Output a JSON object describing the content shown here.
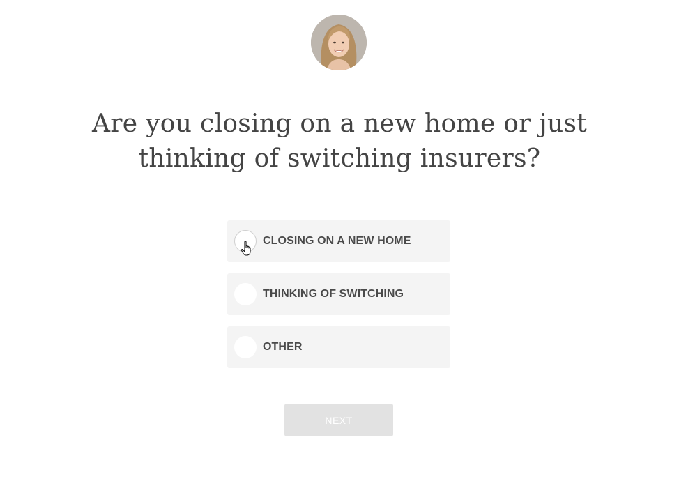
{
  "header": {
    "avatar_icon": "person-avatar-photo"
  },
  "question": {
    "line1": "Are you closing on a new home or just",
    "line2": "thinking of switching insurers?"
  },
  "options": [
    {
      "label": "CLOSING ON A NEW HOME",
      "selected": false
    },
    {
      "label": "THINKING OF SWITCHING",
      "selected": false
    },
    {
      "label": "OTHER",
      "selected": false
    }
  ],
  "next_button": {
    "label": "NEXT",
    "enabled": false
  },
  "colors": {
    "option_background": "#f4f4f4",
    "button_disabled": "#e2e2e2",
    "text": "#444444"
  }
}
